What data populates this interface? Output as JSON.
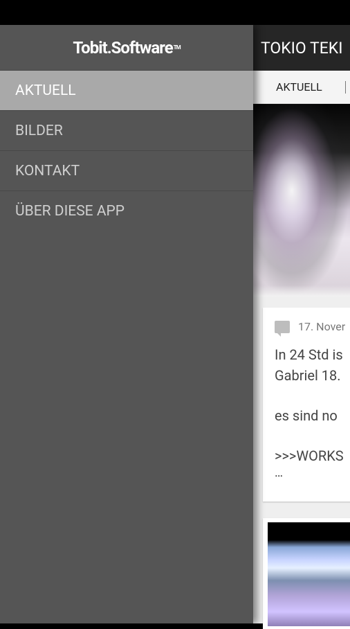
{
  "drawer": {
    "logo": "Tobit.Software",
    "logo_tm": "TM",
    "items": [
      {
        "label": "AKTUELL",
        "active": true
      },
      {
        "label": "BILDER",
        "active": false
      },
      {
        "label": "KONTAKT",
        "active": false
      },
      {
        "label": "ÜBER DIESE APP",
        "active": false
      }
    ]
  },
  "content": {
    "app_title": "TOKIO TEKI",
    "tabs": [
      "AKTUELL"
    ],
    "card": {
      "date": "17. Nover",
      "line1": "In 24 Std is",
      "line2": "Gabriel 18.",
      "line3": " es sind no",
      "line4": " >>>WORKS",
      "ellipsis": "…"
    },
    "colors": {
      "drawer_bg": "#555555",
      "drawer_active": "#a9a9a9",
      "appbar_bg": "#262626"
    }
  }
}
